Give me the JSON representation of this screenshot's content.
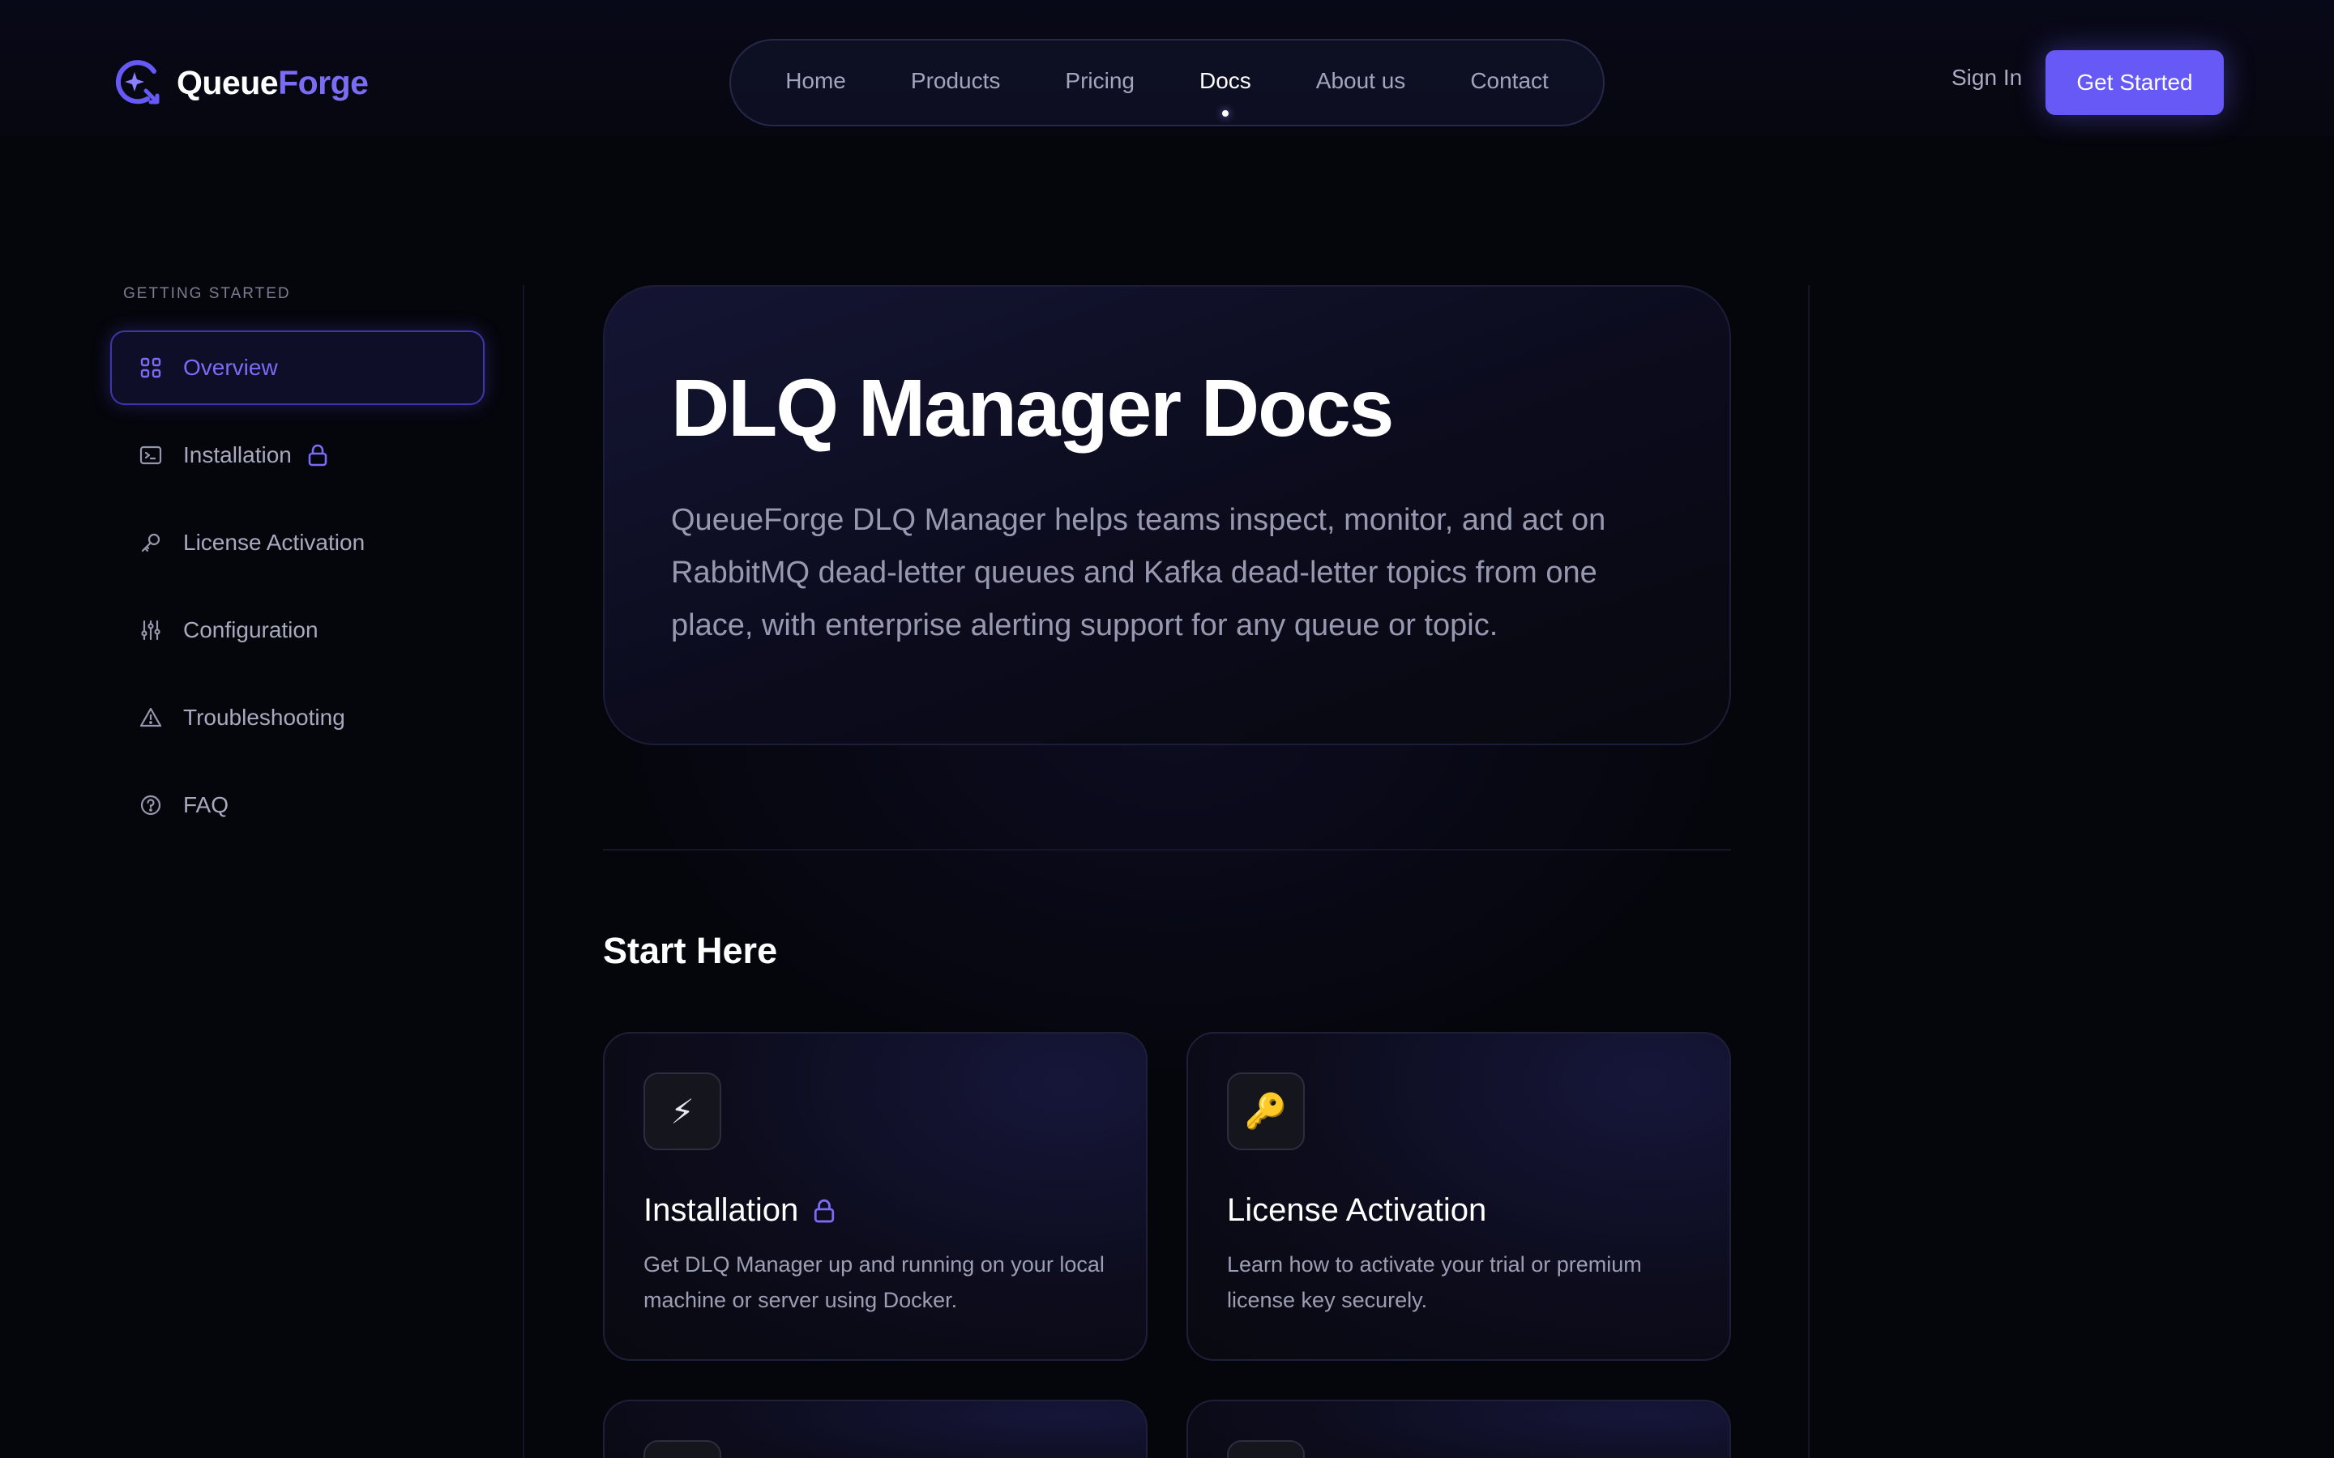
{
  "brand": {
    "name_part1": "Queue",
    "name_part2": "Forge",
    "accent": "#6659f5",
    "accent_text": "#7b6cf6"
  },
  "nav": {
    "items": [
      {
        "label": "Home",
        "active": false
      },
      {
        "label": "Products",
        "active": false
      },
      {
        "label": "Pricing",
        "active": false
      },
      {
        "label": "Docs",
        "active": true
      },
      {
        "label": "About us",
        "active": false
      },
      {
        "label": "Contact",
        "active": false
      }
    ],
    "signin_label": "Sign In",
    "cta_label": "Get Started"
  },
  "sidebar": {
    "section_title": "GETTING STARTED",
    "items": [
      {
        "label": "Overview",
        "icon": "grid-icon",
        "active": true,
        "locked": false
      },
      {
        "label": "Installation",
        "icon": "terminal-icon",
        "active": false,
        "locked": true
      },
      {
        "label": "License Activation",
        "icon": "key-icon",
        "active": false,
        "locked": false
      },
      {
        "label": "Configuration",
        "icon": "sliders-icon",
        "active": false,
        "locked": false
      },
      {
        "label": "Troubleshooting",
        "icon": "warning-icon",
        "active": false,
        "locked": false
      },
      {
        "label": "FAQ",
        "icon": "help-circle-icon",
        "active": false,
        "locked": false
      }
    ]
  },
  "hero": {
    "title": "DLQ Manager Docs",
    "description": "QueueForge DLQ Manager helps teams inspect, monitor, and act on RabbitMQ dead-letter queues and Kafka dead-letter topics from one place, with enterprise alerting support for any queue or topic."
  },
  "start_here": {
    "title": "Start Here",
    "cards": [
      {
        "icon": "⚡",
        "icon_name": "lightning-icon",
        "title": "Installation",
        "locked": true,
        "description": "Get DLQ Manager up and running on your local machine or server using Docker."
      },
      {
        "icon": "🔑",
        "icon_name": "key-icon",
        "title": "License Activation",
        "locked": false,
        "description": "Learn how to activate your trial or premium license key securely."
      }
    ]
  }
}
